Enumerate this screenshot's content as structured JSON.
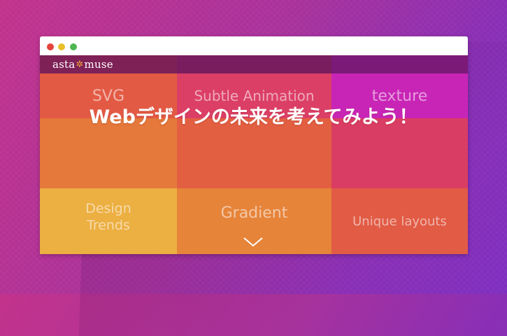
{
  "browser": {
    "logo": {
      "left": "asta",
      "right": "muse",
      "mark": "✲"
    }
  },
  "tiles": {
    "row1": [
      "SVG",
      "Subtle Animation",
      "texture"
    ],
    "row3": {
      "design_line1": "Design",
      "design_line2": "Trends",
      "gradient": "Gradient",
      "unique": "Unique layouts"
    }
  },
  "headline": "Webデザインの未来を考えてみよう！",
  "icons": {
    "scroll": "chevron-down-icon"
  },
  "colors": {
    "background_start": "#c2338c",
    "background_end": "#7f2fc0",
    "headline": "#ffffff"
  }
}
